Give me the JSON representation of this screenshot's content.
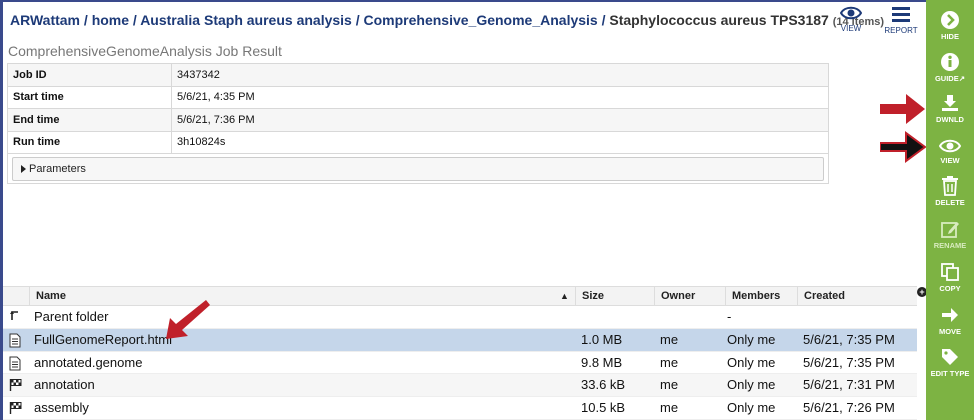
{
  "breadcrumb": {
    "user": "ARWattam",
    "home": "home",
    "folder1": "Australia Staph aureus analysis",
    "folder2": "Comprehensive_Genome_Analysis",
    "current": "Staphylococcus aureus TPS3187",
    "count": "(14 items)",
    "sep": " / "
  },
  "top_actions": {
    "view": "VIEW",
    "report": "REPORT"
  },
  "job": {
    "title": "ComprehensiveGenomeAnalysis Job Result",
    "rows": [
      {
        "key": "Job ID",
        "value": "3437342"
      },
      {
        "key": "Start time",
        "value": "5/6/21, 4:35 PM"
      },
      {
        "key": "End time",
        "value": "5/6/21, 7:36 PM"
      },
      {
        "key": "Run time",
        "value": "3h10824s"
      }
    ],
    "parameters_label": "Parameters"
  },
  "grid": {
    "headers": {
      "name": "Name",
      "size": "Size",
      "owner": "Owner",
      "members": "Members",
      "created": "Created"
    },
    "rows": [
      {
        "icon": "parent-folder-icon",
        "name": "Parent folder",
        "size": "",
        "owner": "",
        "members": "-",
        "created": ""
      },
      {
        "icon": "document-icon",
        "name": "FullGenomeReport.html",
        "size": "1.0 MB",
        "owner": "me",
        "members": "Only me",
        "created": "5/6/21, 7:35 PM"
      },
      {
        "icon": "document-icon",
        "name": "annotated.genome",
        "size": "9.8 MB",
        "owner": "me",
        "members": "Only me",
        "created": "5/6/21, 7:35 PM"
      },
      {
        "icon": "flag-icon",
        "name": "annotation",
        "size": "33.6 kB",
        "owner": "me",
        "members": "Only me",
        "created": "5/6/21, 7:31 PM"
      },
      {
        "icon": "flag-icon",
        "name": "assembly",
        "size": "10.5 kB",
        "owner": "me",
        "members": "Only me",
        "created": "5/6/21, 7:26 PM"
      }
    ]
  },
  "sidebar": {
    "hide": "HIDE",
    "guide": "GUIDE",
    "download": "DWNLD",
    "view": "VIEW",
    "delete": "DELETE",
    "rename": "RENAME",
    "copy": "COPY",
    "move": "MOVE",
    "edit_type": "EDIT TYPE"
  },
  "colors": {
    "sidebar_green": "#7db343",
    "link_blue": "#1d3a78",
    "selection": "#c5d6ea",
    "annotation_red": "#c0202a"
  }
}
